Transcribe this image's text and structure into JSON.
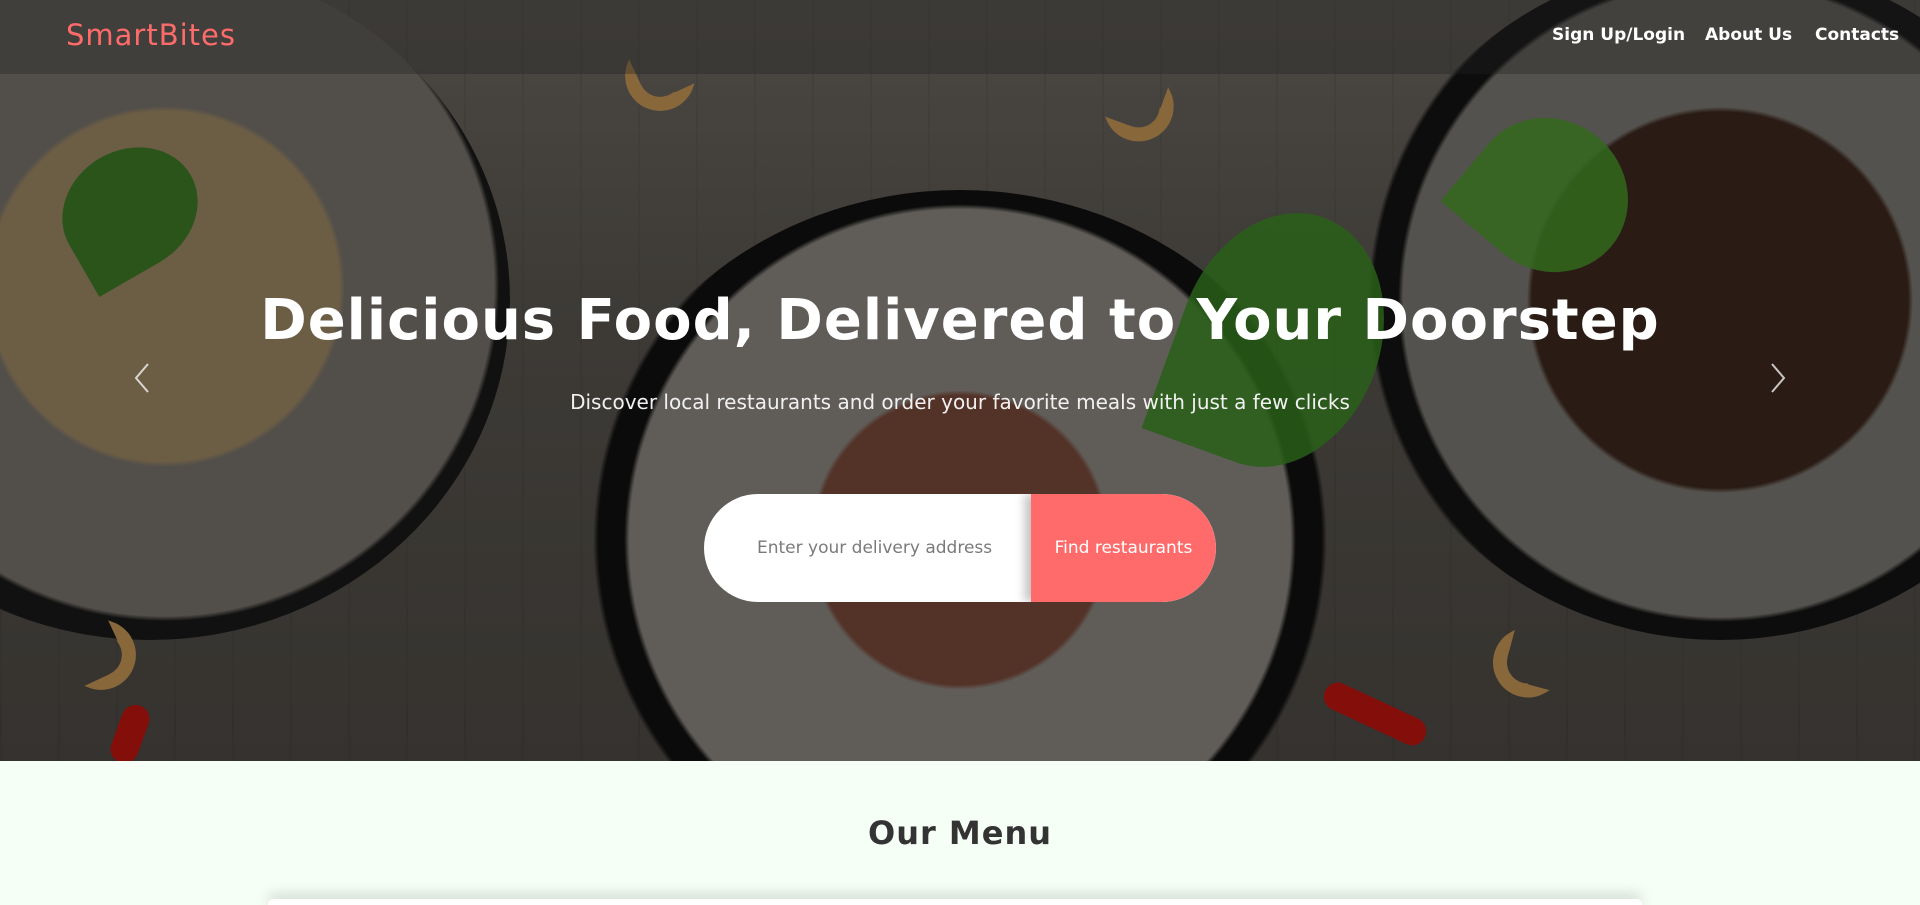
{
  "navbar": {
    "brand": "SmartBites",
    "links": [
      "Sign Up/Login",
      "About Us",
      "Contacts"
    ]
  },
  "hero": {
    "title": "Delicious Food, Delivered to Your Doorstep",
    "subtitle": "Discover local restaurants and order your favorite meals with just a few clicks",
    "search": {
      "placeholder": "Enter your delivery address",
      "value": "",
      "button_label": "Find restaurants"
    },
    "carousel_prev_icon": "chevron-left-icon",
    "carousel_next_icon": "chevron-right-icon"
  },
  "menu_section": {
    "title": "Our Menu"
  },
  "colors": {
    "accent": "#ff6b6b",
    "menu_background": "#f5fff5",
    "text_dark": "#333333"
  }
}
